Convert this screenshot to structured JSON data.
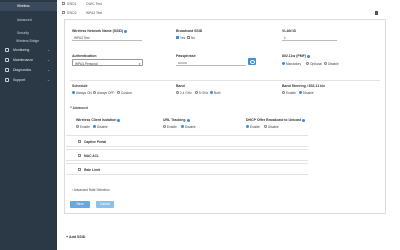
{
  "sidebar": {
    "sub_items": [
      {
        "label": "Wireless",
        "active": true
      },
      {
        "label": "Advanced",
        "active": false
      },
      {
        "label": "Security",
        "active": false
      },
      {
        "label": "Wireless Bridge",
        "active": false
      }
    ],
    "main_items": [
      {
        "label": "Monitoring"
      },
      {
        "label": "Maintenance"
      },
      {
        "label": "Diagnostics"
      },
      {
        "label": "Support"
      }
    ]
  },
  "tabs": [
    {
      "id": "SSID1",
      "name": "CWIC Test"
    },
    {
      "id": "SSID2",
      "name": "WPA3 Test"
    }
  ],
  "form": {
    "ssid_label": "Wireless Network Name (SSID)",
    "ssid_value": "WPA3 Test",
    "broadcast_label": "Broadcast SSID",
    "broadcast_yes": "Yes",
    "broadcast_no": "No",
    "vlan_label": "VLAN ID",
    "vlan_value": "1",
    "auth_label": "Authentication",
    "auth_value": "WPA3-Personal",
    "pass_label": "Passphrase",
    "pass_value": "••••••••",
    "pmf_label": "802.11w (PMF)",
    "pmf_opts": [
      "Mandatory",
      "Optional",
      "Disable"
    ],
    "sched_label": "Schedule",
    "sched_opts": [
      "Always ON",
      "Always OFF",
      "Custom"
    ],
    "band_label": "Band",
    "band_opts": [
      "2.4 GHz",
      "5 GHz",
      "Both"
    ],
    "steer_label": "Band Steering / 802.11 k/v",
    "steer_opts": [
      "Enable",
      "Disable"
    ],
    "advanced_label": "Advanced",
    "isolation_label": "Wireless Client Isolation",
    "isolation_opts": [
      "Enable",
      "Disable"
    ],
    "urltrack_label": "URL Tracking",
    "urltrack_opts": [
      "Enable",
      "Disable"
    ],
    "dhcp_label": "DHCP Offer Broadcast to Unicast",
    "dhcp_opts": [
      "Enable",
      "Disable"
    ],
    "sections": [
      "Captive Portal",
      "MAC ACL",
      "Rate Limit"
    ],
    "adv_rate_label": "Advanced Rate Selection",
    "save_label": "Save",
    "cancel_label": "Cancel"
  },
  "add_ssid_label": "Add SSID"
}
